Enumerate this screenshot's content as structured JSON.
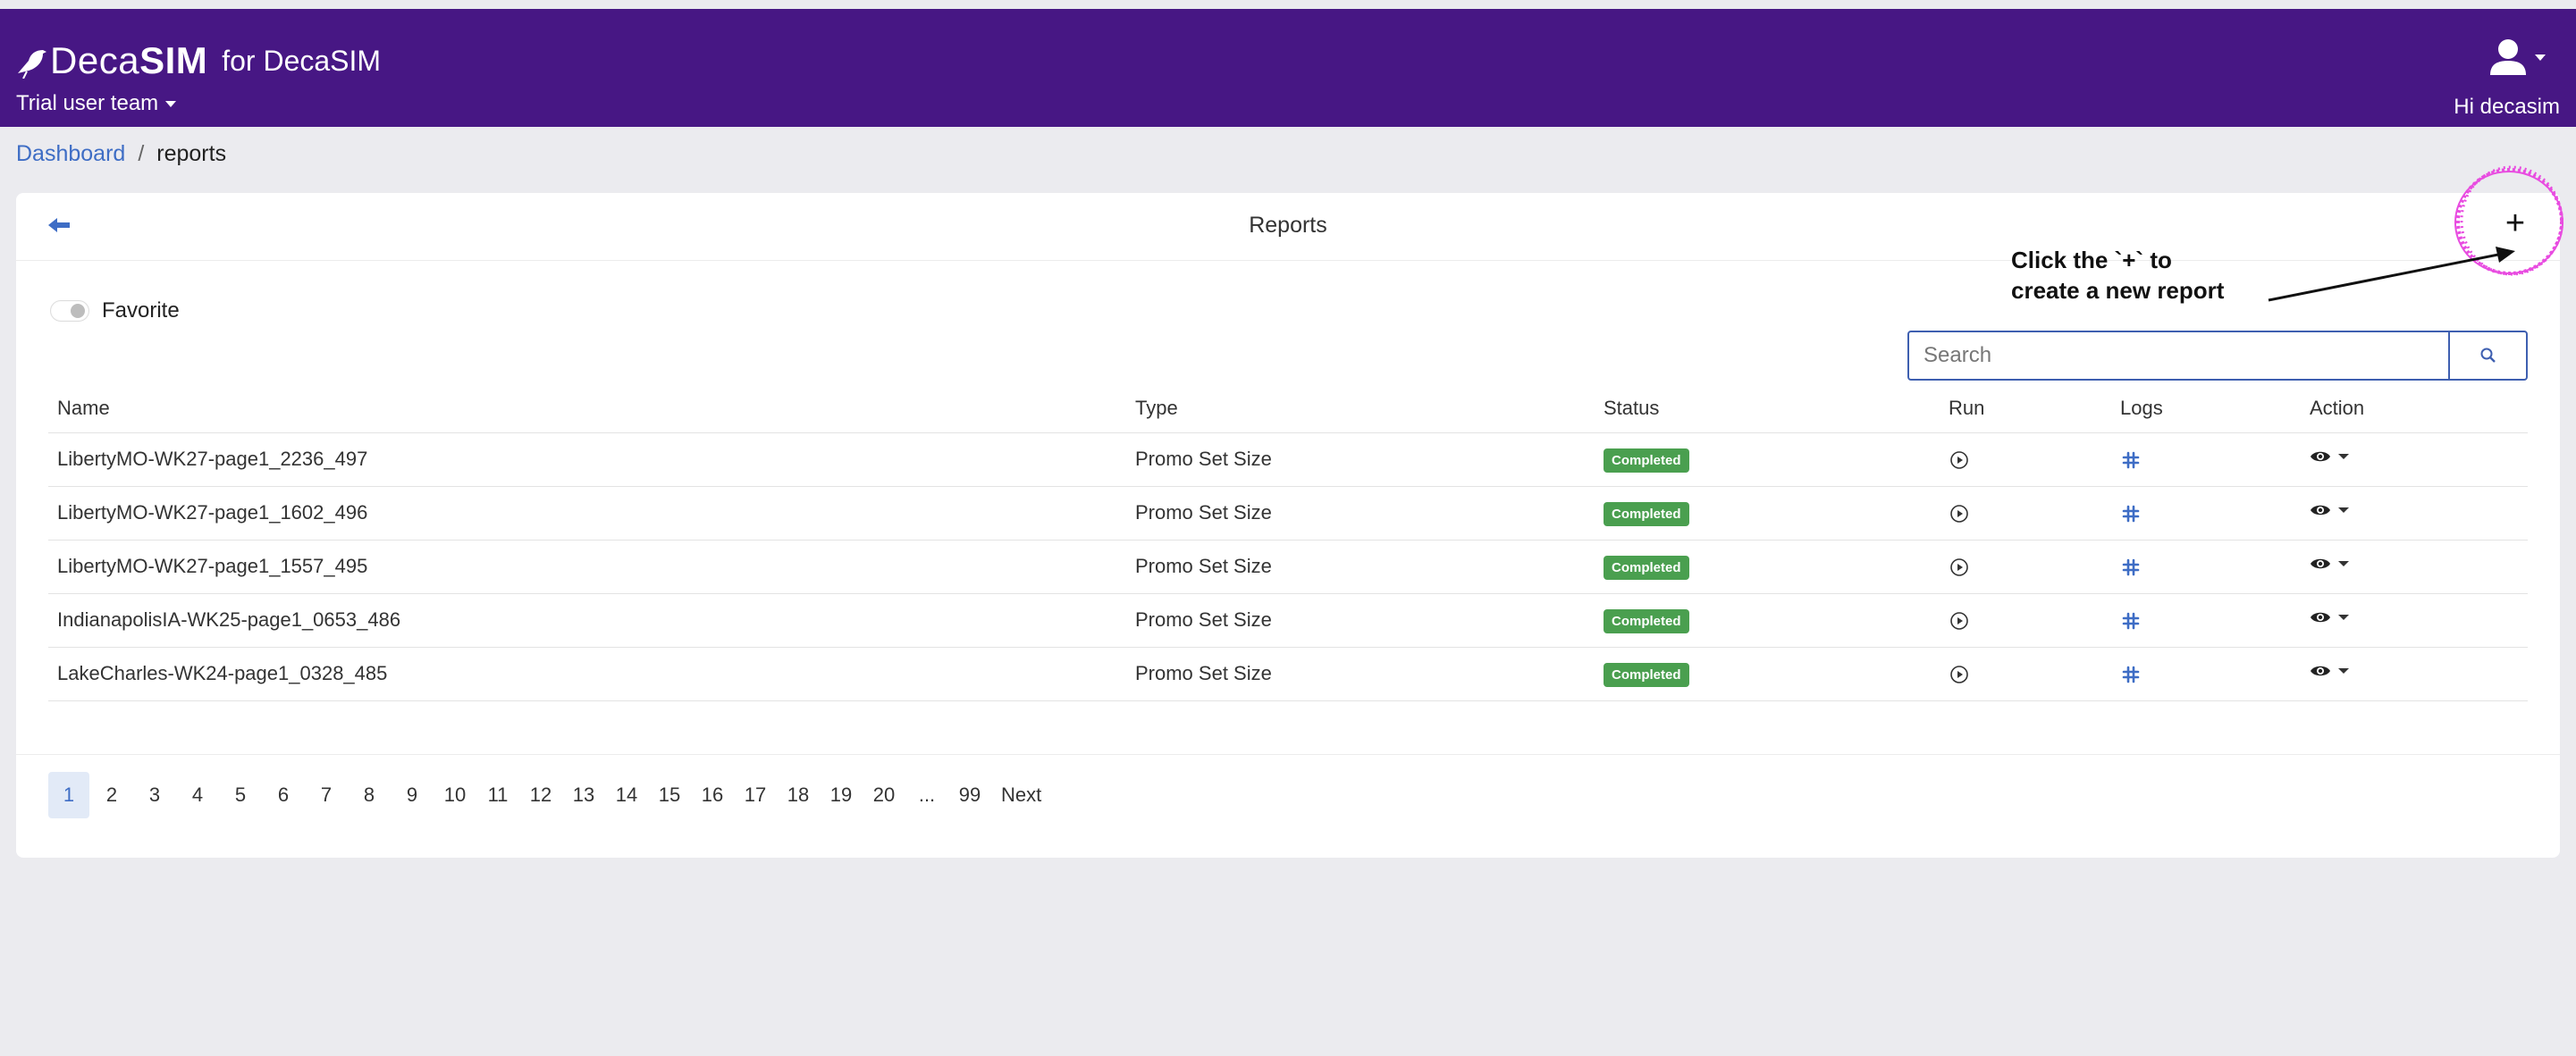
{
  "header": {
    "brand_light": "Deca",
    "brand_bold": "SIM",
    "brand_suffix": "for DecaSIM",
    "team_label": "Trial user team",
    "greeting": "Hi decasim"
  },
  "breadcrumb": {
    "link": "Dashboard",
    "separator": "/",
    "current": "reports"
  },
  "card": {
    "title": "Reports",
    "add_label": "+",
    "annotation_line1": "Click the `+` to",
    "annotation_line2": "create a new report",
    "favorite_label": "Favorite"
  },
  "search": {
    "placeholder": "Search",
    "value": ""
  },
  "table": {
    "columns": [
      "Name",
      "Type",
      "Status",
      "Run",
      "Logs",
      "Action"
    ],
    "rows": [
      {
        "name": "LibertyMO-WK27-page1_2236_497",
        "type": "Promo Set Size",
        "status": "Completed"
      },
      {
        "name": "LibertyMO-WK27-page1_1602_496",
        "type": "Promo Set Size",
        "status": "Completed"
      },
      {
        "name": "LibertyMO-WK27-page1_1557_495",
        "type": "Promo Set Size",
        "status": "Completed"
      },
      {
        "name": "IndianapolisIA-WK25-page1_0653_486",
        "type": "Promo Set Size",
        "status": "Completed"
      },
      {
        "name": "LakeCharles-WK24-page1_0328_485",
        "type": "Promo Set Size",
        "status": "Completed"
      }
    ]
  },
  "pagination": {
    "pages": [
      "1",
      "2",
      "3",
      "4",
      "5",
      "6",
      "7",
      "8",
      "9",
      "10",
      "11",
      "12",
      "13",
      "14",
      "15",
      "16",
      "17",
      "18",
      "19",
      "20",
      "...",
      "99"
    ],
    "active": "1",
    "next_label": "Next"
  },
  "colors": {
    "header_bg": "#471784",
    "link": "#3e6dc5",
    "badge_completed": "#4a9f4f",
    "highlight_ring": "#e84ce0"
  },
  "icons": {
    "logo": "bird-logo-icon",
    "user": "user-avatar-icon",
    "back": "arrow-left-icon",
    "search": "search-icon",
    "run": "play-circle-icon",
    "logs": "slack-hash-icon",
    "action": "eye-icon"
  }
}
